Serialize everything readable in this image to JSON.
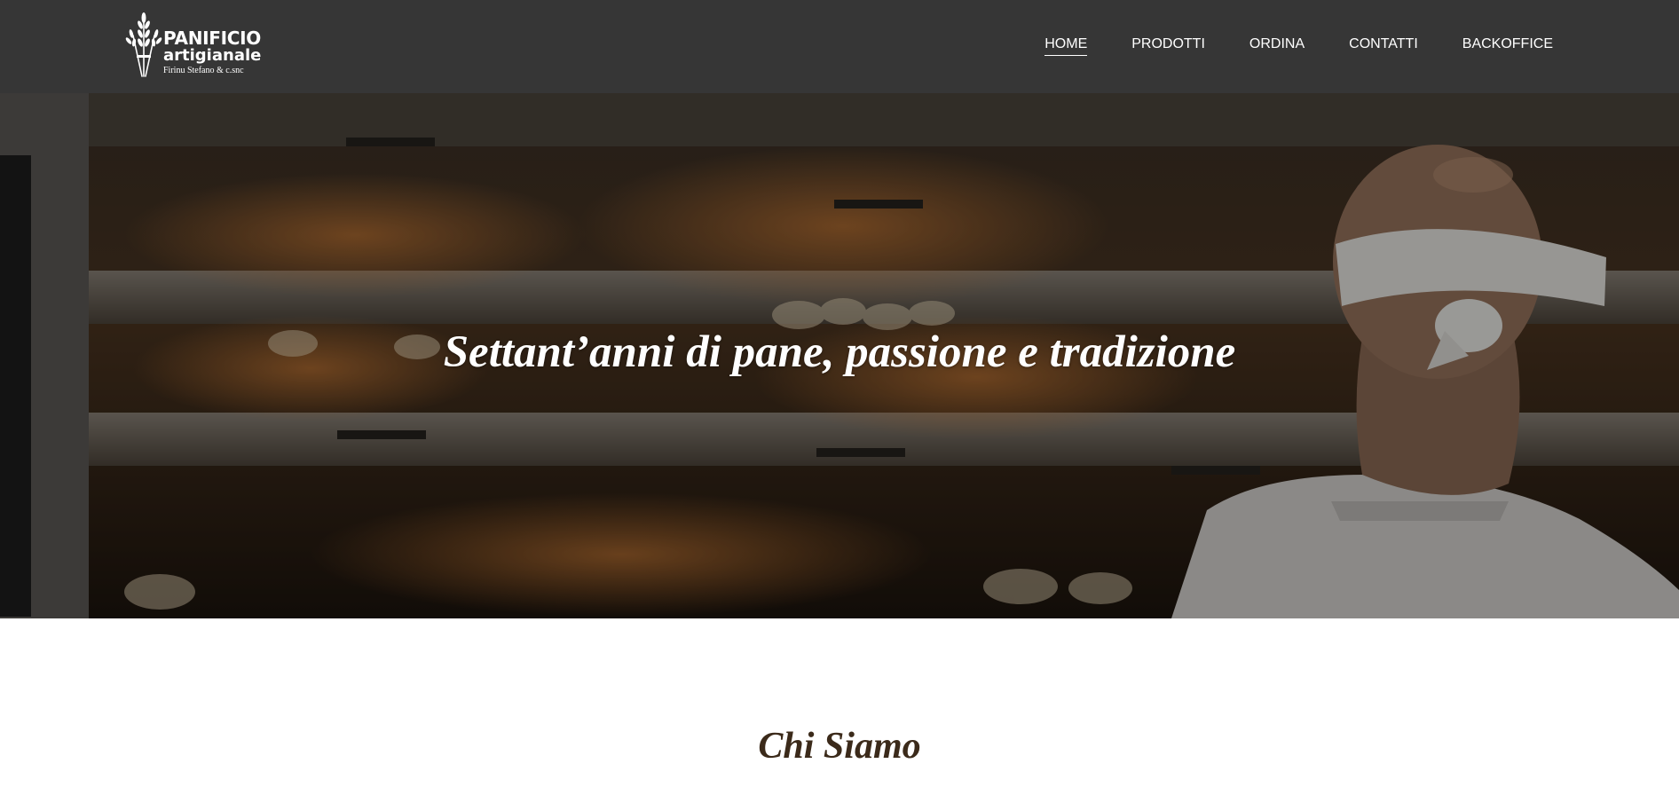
{
  "brand": {
    "line1": "PANIFICIO",
    "line2": "artigianale",
    "line3": "Firinu Stefano & c.snc",
    "icon": "wheat-icon"
  },
  "nav": {
    "items": [
      {
        "label": "HOME",
        "active": true
      },
      {
        "label": "PRODOTTI",
        "active": false
      },
      {
        "label": "ORDINA",
        "active": false
      },
      {
        "label": "CONTATTI",
        "active": false
      },
      {
        "label": "BACKOFFICE",
        "active": false
      }
    ]
  },
  "hero": {
    "title": "Settant’anni di pane, passione e tradizione",
    "image": "baker-at-oven-photo"
  },
  "about": {
    "title": "Chi Siamo"
  },
  "colors": {
    "header_bg": "#363636",
    "nav_text": "#ffffff",
    "section_title": "#3b2a1a"
  }
}
